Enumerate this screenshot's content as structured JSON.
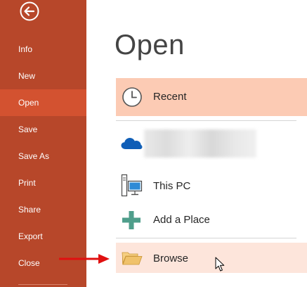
{
  "sidebar": {
    "back_icon": "back-arrow-icon",
    "items": [
      {
        "label": "Info",
        "active": false
      },
      {
        "label": "New",
        "active": false
      },
      {
        "label": "Open",
        "active": true
      },
      {
        "label": "Save",
        "active": false
      },
      {
        "label": "Save As",
        "active": false
      },
      {
        "label": "Print",
        "active": false
      },
      {
        "label": "Share",
        "active": false
      },
      {
        "label": "Export",
        "active": false
      },
      {
        "label": "Close",
        "active": false
      }
    ]
  },
  "main": {
    "title": "Open",
    "places": {
      "recent": {
        "label": "Recent",
        "icon": "clock-icon"
      },
      "onedrive": {
        "label": "",
        "icon": "onedrive-cloud-icon"
      },
      "this_pc": {
        "label": "This PC",
        "icon": "computer-icon"
      },
      "add_place": {
        "label": "Add a Place",
        "icon": "plus-icon"
      },
      "browse": {
        "label": "Browse",
        "icon": "folder-icon"
      }
    }
  },
  "colors": {
    "sidebar": "#b7472a",
    "sidebar_active": "#d35230",
    "recent_highlight": "#fccbb4",
    "browse_highlight": "#fde5db",
    "annotation_arrow": "#e01010"
  }
}
